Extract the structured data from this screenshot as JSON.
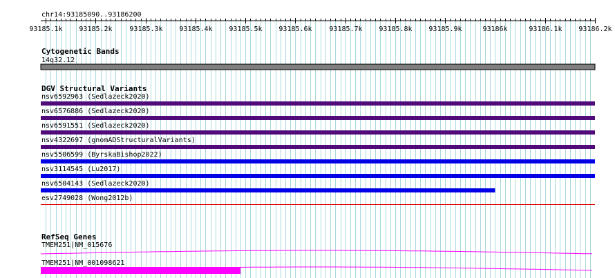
{
  "view": {
    "region_label": "chr14:93185090..93186200",
    "scale_start": 93185090,
    "scale_end": 93186200,
    "minor_step": 10
  },
  "ruler": {
    "ticks": [
      {
        "pos": 93185100,
        "label": "93185.1k"
      },
      {
        "pos": 93185200,
        "label": "93185.2k"
      },
      {
        "pos": 93185300,
        "label": "93185.3k"
      },
      {
        "pos": 93185400,
        "label": "93185.4k"
      },
      {
        "pos": 93185500,
        "label": "93185.5k"
      },
      {
        "pos": 93185600,
        "label": "93185.6k"
      },
      {
        "pos": 93185700,
        "label": "93185.7k"
      },
      {
        "pos": 93185800,
        "label": "93185.8k"
      },
      {
        "pos": 93185900,
        "label": "93185.9k"
      },
      {
        "pos": 93186000,
        "label": "93186k"
      },
      {
        "pos": 93186100,
        "label": "93186.1k"
      },
      {
        "pos": 93186200,
        "label": "93186.2k"
      }
    ]
  },
  "tracks": {
    "cytoband": {
      "title": "Cytogenetic Bands",
      "band_label": "14q32.12",
      "color": "#7f7f7f"
    },
    "dgv": {
      "title": "DGV Structural Variants",
      "features": [
        {
          "label": "nsv6592963 (Sedlazeck2020)",
          "start": 93185090,
          "end": 93186200,
          "color": "#500a7a"
        },
        {
          "label": "nsv6576886 (Sedlazeck2020)",
          "start": 93185090,
          "end": 93186200,
          "color": "#500a7a"
        },
        {
          "label": "nsv6591551 (Sedlazeck2020)",
          "start": 93185090,
          "end": 93186200,
          "color": "#500a7a"
        },
        {
          "label": "nsv4322697 (gnomADStructuralVariants)",
          "start": 93185090,
          "end": 93186200,
          "color": "#500a7a"
        },
        {
          "label": "nsv5506599 (ByrskaBishop2022)",
          "start": 93185090,
          "end": 93186200,
          "color": "#0000e6"
        },
        {
          "label": "nsv3114545 (Lu2017)",
          "start": 93185090,
          "end": 93186200,
          "color": "#0000e6"
        },
        {
          "label": "nsv6504143 (Sedlazeck2020)",
          "start": 93185090,
          "end": 93186000,
          "color": "#0000e6"
        },
        {
          "label": "esv2749028 (Wong2012b)",
          "start": 93185090,
          "end": 93186200,
          "color": "#e60000",
          "thin": true
        }
      ]
    },
    "refseq": {
      "title": "RefSeq Genes",
      "color": "#ff00ff",
      "genes": [
        {
          "label": "TMEM251|NM_015676",
          "exon_end": null
        },
        {
          "label": "TMEM251|NM_001098621",
          "exon_end": 93185490
        }
      ]
    }
  }
}
